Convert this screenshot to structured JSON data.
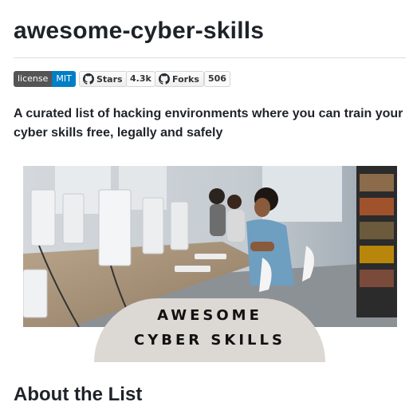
{
  "readme": {
    "title": "awesome-cyber-skills",
    "description": "A curated list of hacking environments where you can train your cyber skills free, legally and safely",
    "next_heading": "About the List"
  },
  "badges": {
    "license": {
      "key": "license",
      "value": "MIT",
      "key_color": "#555555",
      "value_color": "#007ec6"
    },
    "stars": {
      "label": "Stars",
      "count": "4.3k",
      "icon": "github-icon"
    },
    "forks": {
      "label": "Forks",
      "count": "506",
      "icon": "github-icon"
    }
  },
  "banner": {
    "line1": "AWESOME",
    "line2": "CYBER SKILLS",
    "arc_color": "#dcd8d3"
  }
}
